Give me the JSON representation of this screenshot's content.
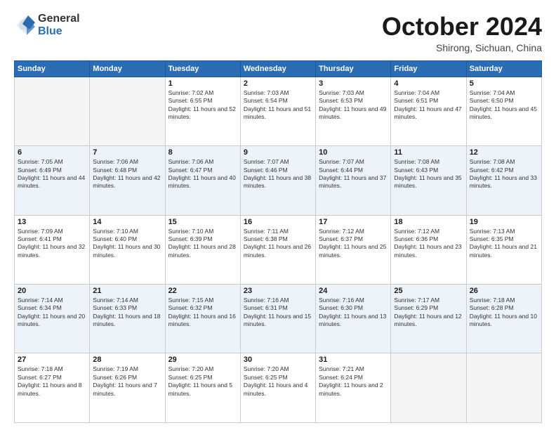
{
  "header": {
    "logo_general": "General",
    "logo_blue": "Blue",
    "month": "October 2024",
    "location": "Shirong, Sichuan, China"
  },
  "weekdays": [
    "Sunday",
    "Monday",
    "Tuesday",
    "Wednesday",
    "Thursday",
    "Friday",
    "Saturday"
  ],
  "weeks": [
    {
      "alt": false,
      "days": [
        {
          "num": "",
          "info": ""
        },
        {
          "num": "",
          "info": ""
        },
        {
          "num": "1",
          "info": "Sunrise: 7:02 AM\nSunset: 6:55 PM\nDaylight: 11 hours and 52 minutes."
        },
        {
          "num": "2",
          "info": "Sunrise: 7:03 AM\nSunset: 6:54 PM\nDaylight: 11 hours and 51 minutes."
        },
        {
          "num": "3",
          "info": "Sunrise: 7:03 AM\nSunset: 6:53 PM\nDaylight: 11 hours and 49 minutes."
        },
        {
          "num": "4",
          "info": "Sunrise: 7:04 AM\nSunset: 6:51 PM\nDaylight: 11 hours and 47 minutes."
        },
        {
          "num": "5",
          "info": "Sunrise: 7:04 AM\nSunset: 6:50 PM\nDaylight: 11 hours and 45 minutes."
        }
      ]
    },
    {
      "alt": true,
      "days": [
        {
          "num": "6",
          "info": "Sunrise: 7:05 AM\nSunset: 6:49 PM\nDaylight: 11 hours and 44 minutes."
        },
        {
          "num": "7",
          "info": "Sunrise: 7:06 AM\nSunset: 6:48 PM\nDaylight: 11 hours and 42 minutes."
        },
        {
          "num": "8",
          "info": "Sunrise: 7:06 AM\nSunset: 6:47 PM\nDaylight: 11 hours and 40 minutes."
        },
        {
          "num": "9",
          "info": "Sunrise: 7:07 AM\nSunset: 6:46 PM\nDaylight: 11 hours and 38 minutes."
        },
        {
          "num": "10",
          "info": "Sunrise: 7:07 AM\nSunset: 6:44 PM\nDaylight: 11 hours and 37 minutes."
        },
        {
          "num": "11",
          "info": "Sunrise: 7:08 AM\nSunset: 6:43 PM\nDaylight: 11 hours and 35 minutes."
        },
        {
          "num": "12",
          "info": "Sunrise: 7:08 AM\nSunset: 6:42 PM\nDaylight: 11 hours and 33 minutes."
        }
      ]
    },
    {
      "alt": false,
      "days": [
        {
          "num": "13",
          "info": "Sunrise: 7:09 AM\nSunset: 6:41 PM\nDaylight: 11 hours and 32 minutes."
        },
        {
          "num": "14",
          "info": "Sunrise: 7:10 AM\nSunset: 6:40 PM\nDaylight: 11 hours and 30 minutes."
        },
        {
          "num": "15",
          "info": "Sunrise: 7:10 AM\nSunset: 6:39 PM\nDaylight: 11 hours and 28 minutes."
        },
        {
          "num": "16",
          "info": "Sunrise: 7:11 AM\nSunset: 6:38 PM\nDaylight: 11 hours and 26 minutes."
        },
        {
          "num": "17",
          "info": "Sunrise: 7:12 AM\nSunset: 6:37 PM\nDaylight: 11 hours and 25 minutes."
        },
        {
          "num": "18",
          "info": "Sunrise: 7:12 AM\nSunset: 6:36 PM\nDaylight: 11 hours and 23 minutes."
        },
        {
          "num": "19",
          "info": "Sunrise: 7:13 AM\nSunset: 6:35 PM\nDaylight: 11 hours and 21 minutes."
        }
      ]
    },
    {
      "alt": true,
      "days": [
        {
          "num": "20",
          "info": "Sunrise: 7:14 AM\nSunset: 6:34 PM\nDaylight: 11 hours and 20 minutes."
        },
        {
          "num": "21",
          "info": "Sunrise: 7:14 AM\nSunset: 6:33 PM\nDaylight: 11 hours and 18 minutes."
        },
        {
          "num": "22",
          "info": "Sunrise: 7:15 AM\nSunset: 6:32 PM\nDaylight: 11 hours and 16 minutes."
        },
        {
          "num": "23",
          "info": "Sunrise: 7:16 AM\nSunset: 6:31 PM\nDaylight: 11 hours and 15 minutes."
        },
        {
          "num": "24",
          "info": "Sunrise: 7:16 AM\nSunset: 6:30 PM\nDaylight: 11 hours and 13 minutes."
        },
        {
          "num": "25",
          "info": "Sunrise: 7:17 AM\nSunset: 6:29 PM\nDaylight: 11 hours and 12 minutes."
        },
        {
          "num": "26",
          "info": "Sunrise: 7:18 AM\nSunset: 6:28 PM\nDaylight: 11 hours and 10 minutes."
        }
      ]
    },
    {
      "alt": false,
      "days": [
        {
          "num": "27",
          "info": "Sunrise: 7:18 AM\nSunset: 6:27 PM\nDaylight: 11 hours and 8 minutes."
        },
        {
          "num": "28",
          "info": "Sunrise: 7:19 AM\nSunset: 6:26 PM\nDaylight: 11 hours and 7 minutes."
        },
        {
          "num": "29",
          "info": "Sunrise: 7:20 AM\nSunset: 6:25 PM\nDaylight: 11 hours and 5 minutes."
        },
        {
          "num": "30",
          "info": "Sunrise: 7:20 AM\nSunset: 6:25 PM\nDaylight: 11 hours and 4 minutes."
        },
        {
          "num": "31",
          "info": "Sunrise: 7:21 AM\nSunset: 6:24 PM\nDaylight: 11 hours and 2 minutes."
        },
        {
          "num": "",
          "info": ""
        },
        {
          "num": "",
          "info": ""
        }
      ]
    }
  ]
}
